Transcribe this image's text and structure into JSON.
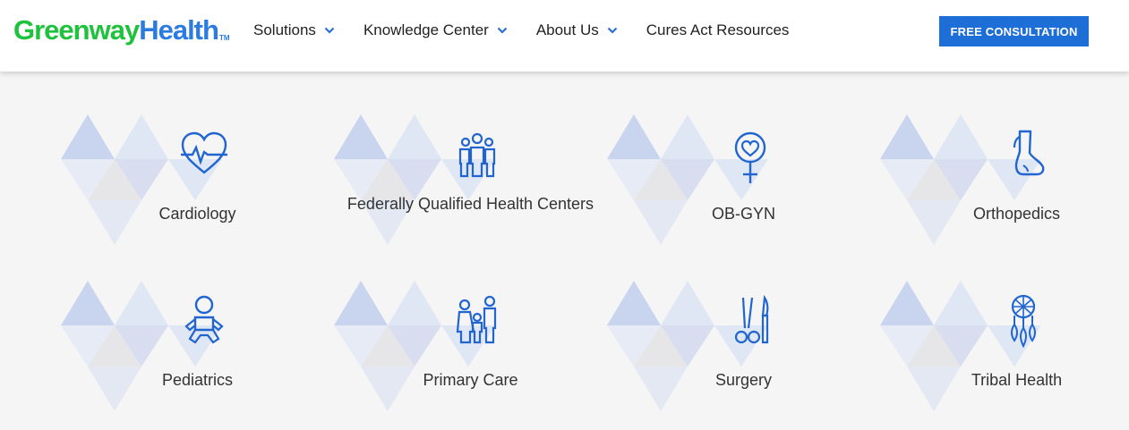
{
  "brand": {
    "name_part1": "Greenway",
    "name_part2": "Health",
    "tm": "TM"
  },
  "nav": {
    "items": [
      {
        "label": "Solutions",
        "has_dropdown": true
      },
      {
        "label": "Knowledge Center",
        "has_dropdown": true
      },
      {
        "label": "About Us",
        "has_dropdown": true
      },
      {
        "label": "Cures Act Resources",
        "has_dropdown": false
      }
    ],
    "cta_label": "FREE CONSULTATION"
  },
  "specialties": [
    {
      "label": "Cardiology",
      "icon": "heart-pulse-icon"
    },
    {
      "label": "Federally Qualified Health Centers",
      "icon": "people-group-icon"
    },
    {
      "label": "OB-GYN",
      "icon": "female-heart-icon"
    },
    {
      "label": "Orthopedics",
      "icon": "foot-icon"
    },
    {
      "label": "Pediatrics",
      "icon": "baby-icon"
    },
    {
      "label": "Primary Care",
      "icon": "family-icon"
    },
    {
      "label": "Surgery",
      "icon": "surgical-tools-icon"
    },
    {
      "label": "Tribal Health",
      "icon": "dreamcatcher-icon"
    }
  ],
  "colors": {
    "accent": "#1e6ed8",
    "brand_green": "#1fc23c",
    "brand_blue": "#2b7be0",
    "icon_blue": "#2165d1"
  }
}
